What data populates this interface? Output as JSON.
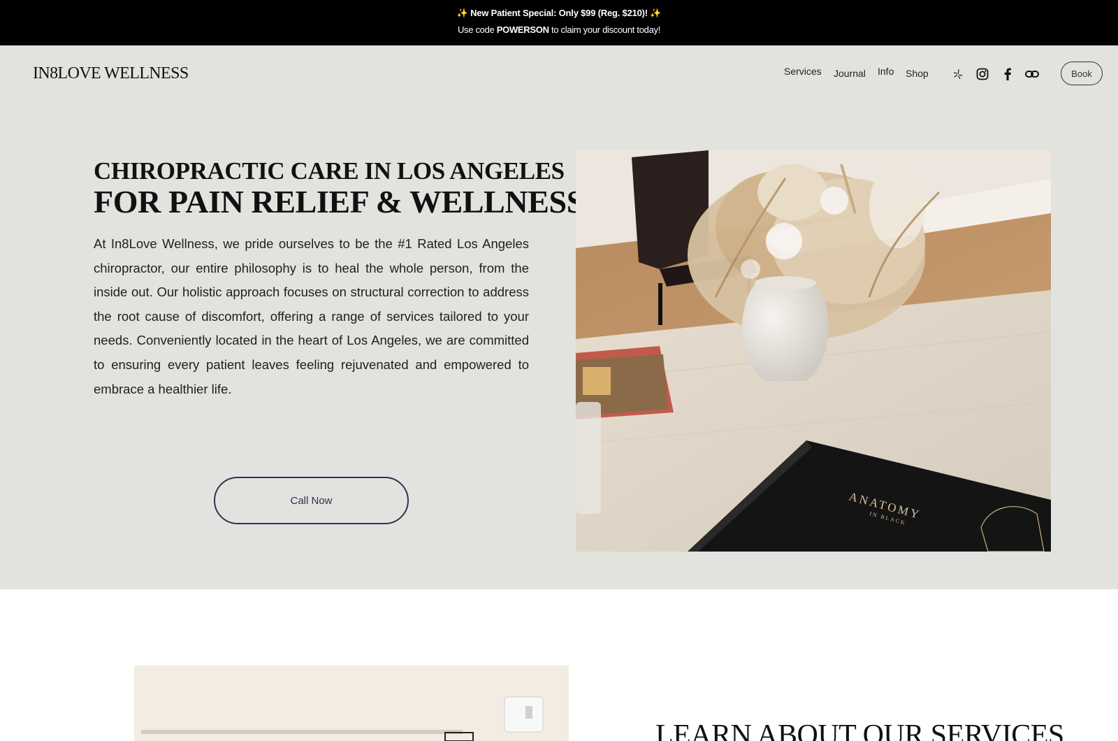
{
  "announcement": {
    "spark": "✨",
    "line1": "New Patient Special: Only $99 (Reg. $210)!",
    "line2_prefix": "Use code",
    "line2_code": "POWERSON",
    "line2_suffix": "to claim your discount today!"
  },
  "header": {
    "logo": "IN8LOVE WELLNESS",
    "nav": [
      "Services",
      "Journal",
      "Info",
      "Shop"
    ],
    "social_icons": [
      "yelp-icon",
      "instagram-icon",
      "facebook-icon",
      "link-icon"
    ],
    "book_label": "Book"
  },
  "hero": {
    "headline_line1": "CHIROPRACTIC CARE IN LOS ANGELES",
    "headline_line2": "FOR PAIN RELIEF & WELLNESS",
    "intro": "At In8Love Wellness, we pride ourselves to be the #1 Rated Los Angeles chiropractor, our entire philosophy is to heal the whole person, from the inside out. Our holistic approach focuses on structural correction to address the root cause of discomfort, offering a range of services tailored to your needs. Conveniently located in the heart of Los Angeles, we are committed to ensuring every patient leaves feeling rejuvenated and empowered to embrace a healthier life.",
    "cta_label": "Call Now",
    "photo_book_text": "ANATOMY",
    "photo_book_subtext": "IN BLACK"
  },
  "services": {
    "heading": "LEARN ABOUT OUR SERVICES"
  },
  "colors": {
    "hero_bg": "#e2e2df",
    "announcement_bg": "#000000",
    "cta_border": "#2b3550"
  }
}
